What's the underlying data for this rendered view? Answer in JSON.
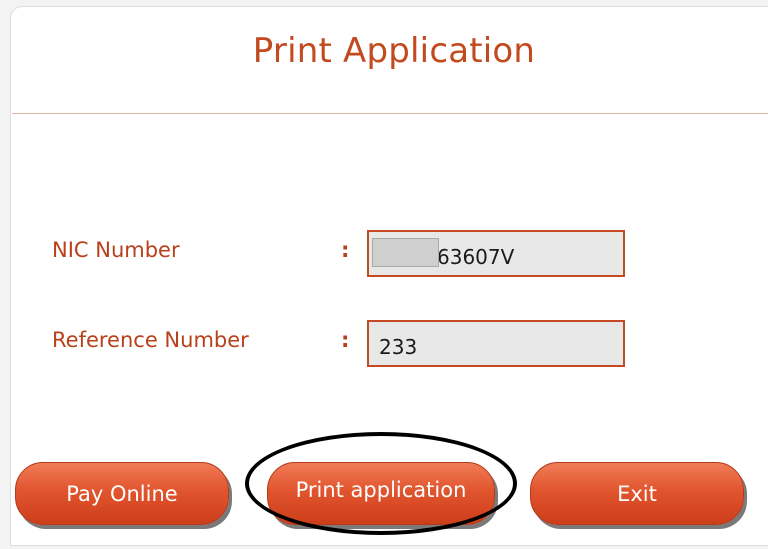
{
  "page": {
    "title": "Print Application"
  },
  "form": {
    "nic_label": "NIC Number",
    "nic_colon": ":",
    "nic_value": "63607V",
    "ref_label": "Reference Number",
    "ref_colon": ":",
    "ref_value": "233"
  },
  "buttons": {
    "pay_online": "Pay Online",
    "print_application": "Print application",
    "exit": "Exit"
  },
  "colors": {
    "accent": "#c24a1e",
    "button": "#e1552e",
    "field_border": "#c44a24",
    "field_bg": "#e8e8e8"
  }
}
